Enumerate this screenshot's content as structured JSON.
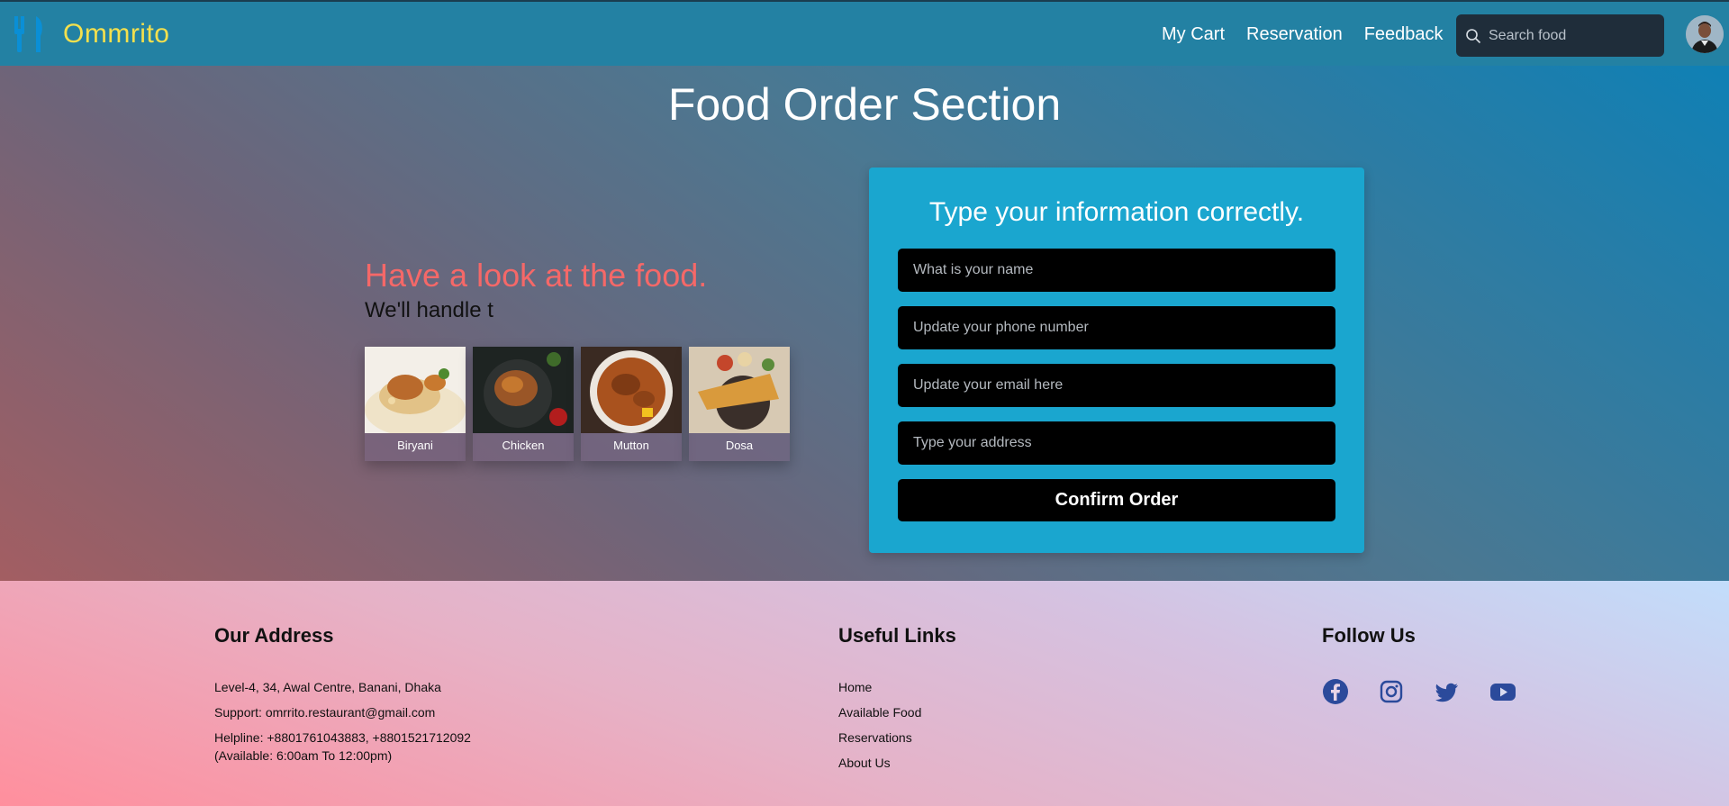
{
  "nav": {
    "brand": "Ommrito",
    "links": [
      "My Cart",
      "Reservation",
      "Feedback"
    ],
    "search_placeholder": "Search food"
  },
  "hero": {
    "title": "Food Order Section",
    "tagline": "Have a look at the food.",
    "subtagline": "We'll handle t",
    "foods": [
      "Biryani",
      "Chicken",
      "Mutton",
      "Dosa"
    ]
  },
  "form": {
    "heading": "Type your information correctly.",
    "name_placeholder": "What is your name",
    "phone_placeholder": "Update your phone number",
    "email_placeholder": "Update your email here",
    "address_placeholder": "Type your address",
    "submit_label": "Confirm Order"
  },
  "footer": {
    "address": {
      "heading": "Our Address",
      "line1": "Level-4, 34, Awal Centre, Banani, Dhaka",
      "line2": "Support: omrrito.restaurant@gmail.com",
      "line3": "Helpline: +8801761043883, +8801521712092",
      "line4": "(Available: 6:00am To 12:00pm)"
    },
    "links": {
      "heading": "Useful Links",
      "items": [
        "Home",
        "Available Food",
        "Reservations",
        "About Us"
      ]
    },
    "social": {
      "heading": "Follow Us",
      "icons": [
        "facebook-icon",
        "instagram-icon",
        "twitter-icon",
        "youtube-icon"
      ]
    }
  },
  "colors": {
    "navbar": "#2381a3",
    "brand": "#f4e04d",
    "tagline": "#f56868",
    "form_card": "#1aa6cf",
    "social": "#2b4a9b"
  }
}
